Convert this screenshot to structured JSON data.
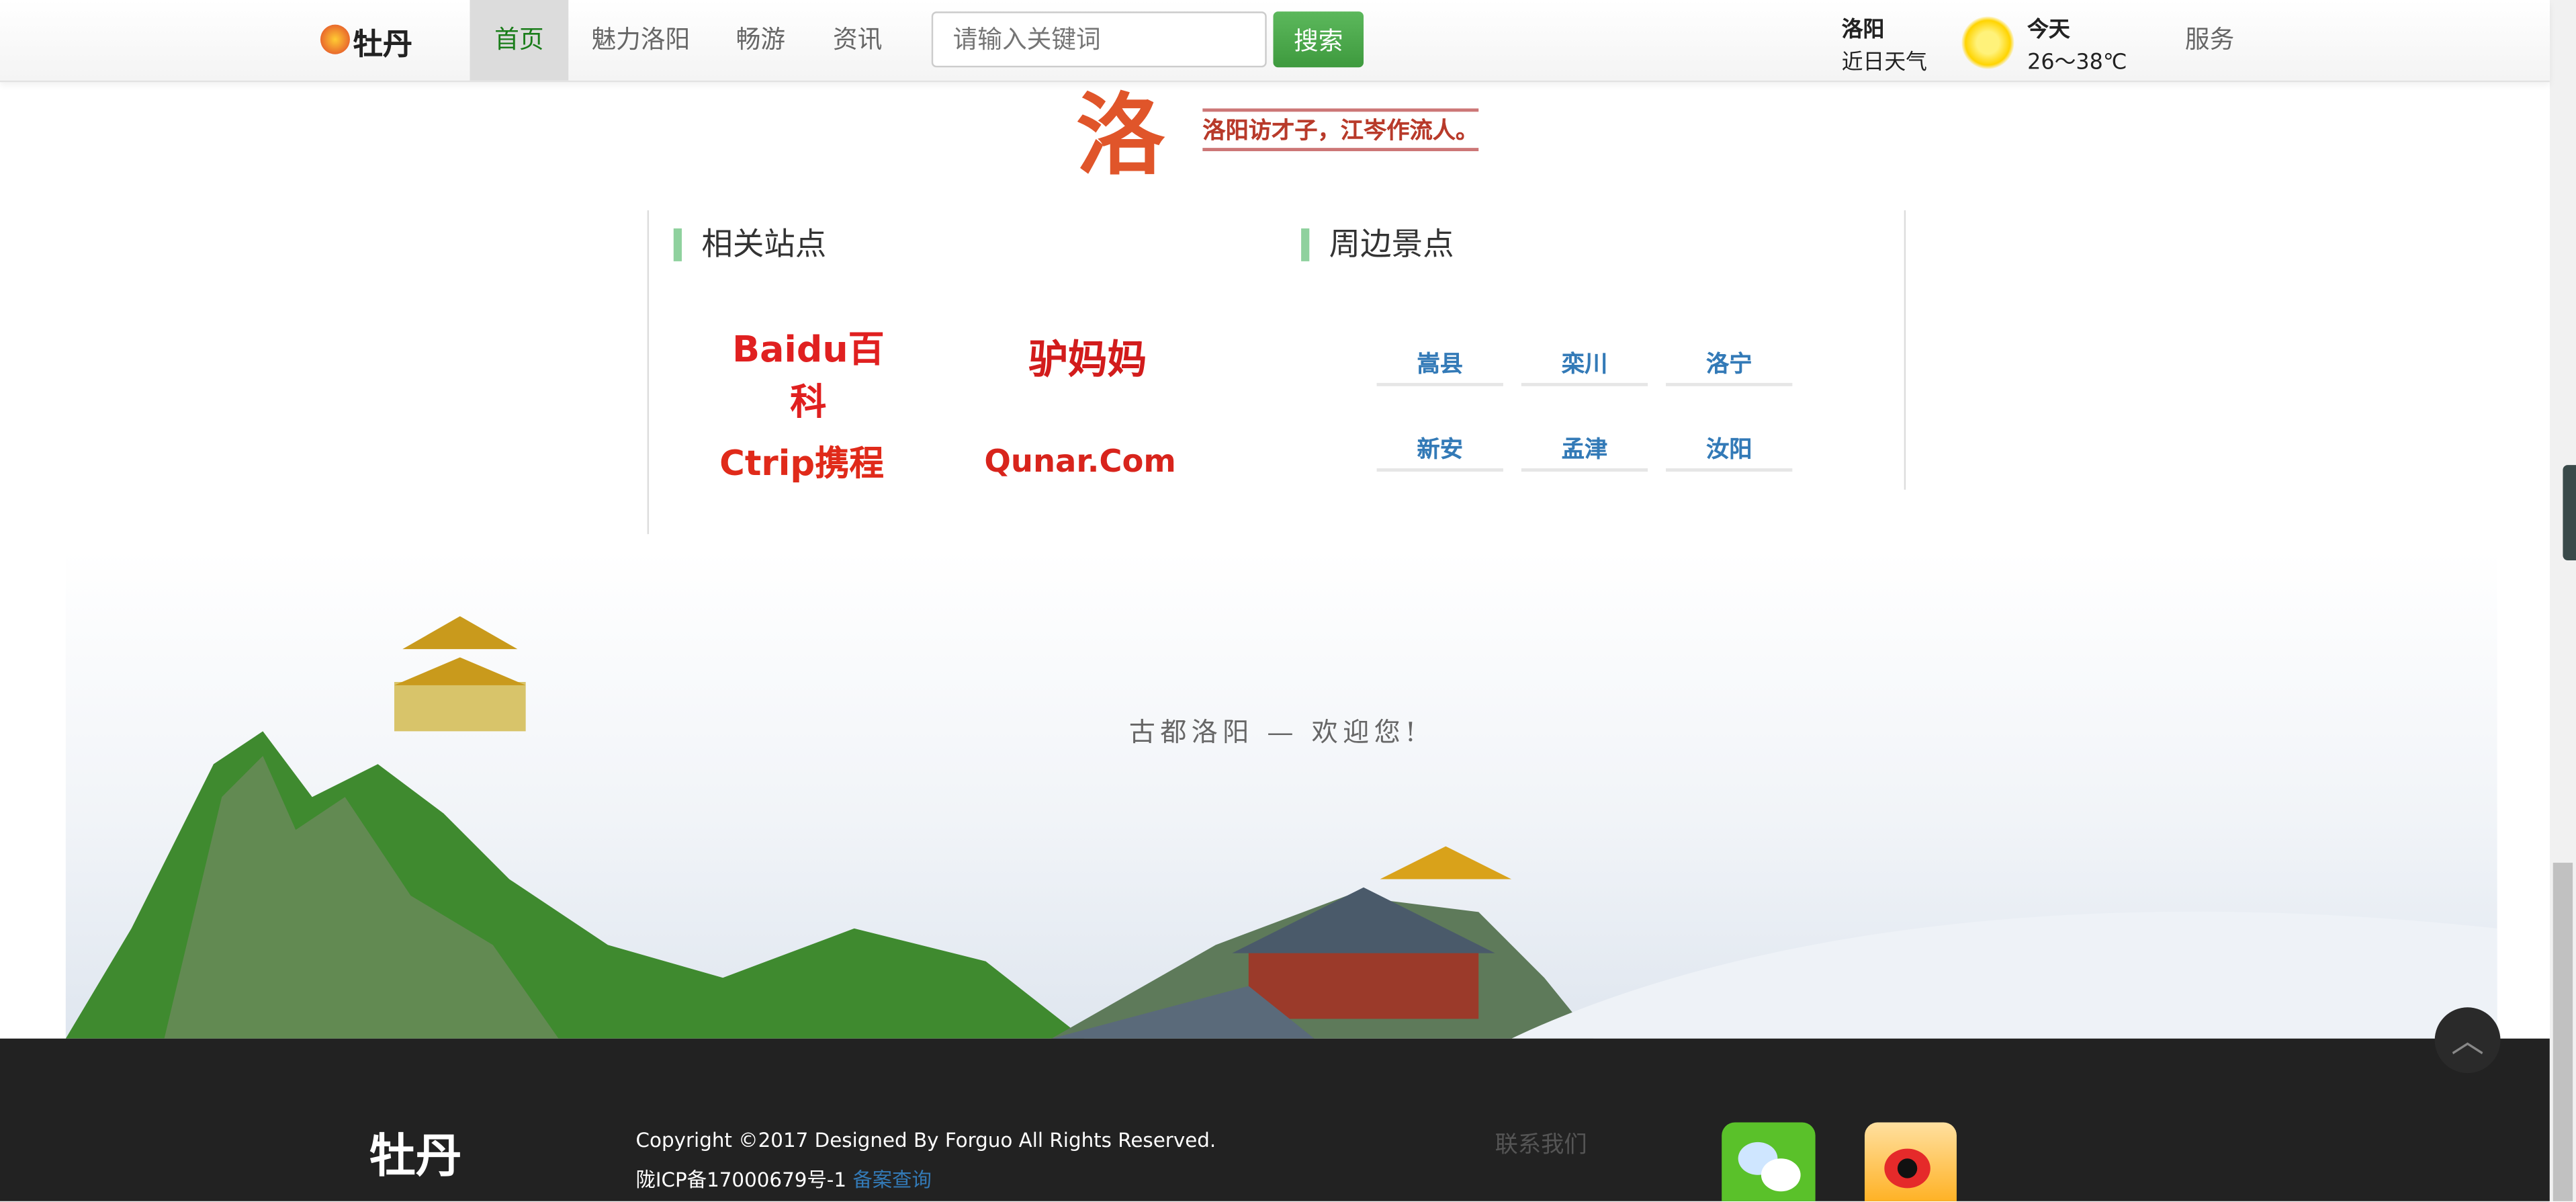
{
  "header": {
    "logo_text": "牡丹",
    "nav": [
      {
        "label": "首页",
        "active": true
      },
      {
        "label": "魅力洛阳",
        "active": false
      },
      {
        "label": "畅游",
        "active": false
      },
      {
        "label": "资讯",
        "active": false
      }
    ],
    "search_placeholder": "请输入关键词",
    "search_button": "搜索",
    "weather": {
      "city": "洛阳",
      "label": "近日天气",
      "icon": "sun-icon",
      "day": "今天",
      "temp": "26～38℃"
    },
    "service": "服务"
  },
  "banner": {
    "caption": "洛阳访才子，江岑作流人。"
  },
  "related_sites": {
    "title": "相关站点",
    "sites": [
      {
        "name": "Baidu百科"
      },
      {
        "name": "驴妈妈"
      },
      {
        "name": "Ctrip携程"
      },
      {
        "name": "Qunar.Com"
      }
    ]
  },
  "nearby": {
    "title": "周边景点",
    "spots": [
      "嵩县",
      "栾川",
      "洛宁",
      "新安",
      "孟津",
      "汝阳"
    ]
  },
  "welcome": "古都洛阳 — 欢迎您!",
  "footer": {
    "copyright": "Copyright ©2017 Designed By Forguo All Rights Reserved.",
    "icp": "陇ICP备17000679号-1",
    "icp_link": "备案查询",
    "contact": "联系我们"
  },
  "colors": {
    "accent": "#4cae4c",
    "link": "#337ab7",
    "footer_bg": "#222222"
  }
}
